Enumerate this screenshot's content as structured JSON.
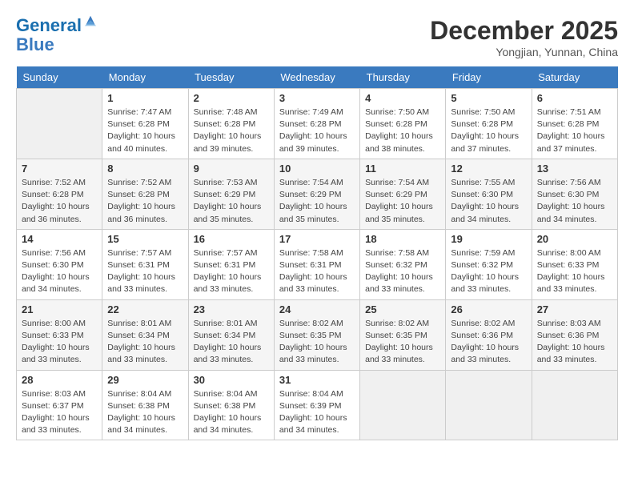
{
  "logo": {
    "line1": "General",
    "line2": "Blue"
  },
  "title": "December 2025",
  "location": "Yongjian, Yunnan, China",
  "days_of_week": [
    "Sunday",
    "Monday",
    "Tuesday",
    "Wednesday",
    "Thursday",
    "Friday",
    "Saturday"
  ],
  "weeks": [
    [
      {
        "day": "",
        "sunrise": "",
        "sunset": "",
        "daylight": ""
      },
      {
        "day": "1",
        "sunrise": "Sunrise: 7:47 AM",
        "sunset": "Sunset: 6:28 PM",
        "daylight": "Daylight: 10 hours and 40 minutes."
      },
      {
        "day": "2",
        "sunrise": "Sunrise: 7:48 AM",
        "sunset": "Sunset: 6:28 PM",
        "daylight": "Daylight: 10 hours and 39 minutes."
      },
      {
        "day": "3",
        "sunrise": "Sunrise: 7:49 AM",
        "sunset": "Sunset: 6:28 PM",
        "daylight": "Daylight: 10 hours and 39 minutes."
      },
      {
        "day": "4",
        "sunrise": "Sunrise: 7:50 AM",
        "sunset": "Sunset: 6:28 PM",
        "daylight": "Daylight: 10 hours and 38 minutes."
      },
      {
        "day": "5",
        "sunrise": "Sunrise: 7:50 AM",
        "sunset": "Sunset: 6:28 PM",
        "daylight": "Daylight: 10 hours and 37 minutes."
      },
      {
        "day": "6",
        "sunrise": "Sunrise: 7:51 AM",
        "sunset": "Sunset: 6:28 PM",
        "daylight": "Daylight: 10 hours and 37 minutes."
      }
    ],
    [
      {
        "day": "7",
        "sunrise": "Sunrise: 7:52 AM",
        "sunset": "Sunset: 6:28 PM",
        "daylight": "Daylight: 10 hours and 36 minutes."
      },
      {
        "day": "8",
        "sunrise": "Sunrise: 7:52 AM",
        "sunset": "Sunset: 6:28 PM",
        "daylight": "Daylight: 10 hours and 36 minutes."
      },
      {
        "day": "9",
        "sunrise": "Sunrise: 7:53 AM",
        "sunset": "Sunset: 6:29 PM",
        "daylight": "Daylight: 10 hours and 35 minutes."
      },
      {
        "day": "10",
        "sunrise": "Sunrise: 7:54 AM",
        "sunset": "Sunset: 6:29 PM",
        "daylight": "Daylight: 10 hours and 35 minutes."
      },
      {
        "day": "11",
        "sunrise": "Sunrise: 7:54 AM",
        "sunset": "Sunset: 6:29 PM",
        "daylight": "Daylight: 10 hours and 35 minutes."
      },
      {
        "day": "12",
        "sunrise": "Sunrise: 7:55 AM",
        "sunset": "Sunset: 6:30 PM",
        "daylight": "Daylight: 10 hours and 34 minutes."
      },
      {
        "day": "13",
        "sunrise": "Sunrise: 7:56 AM",
        "sunset": "Sunset: 6:30 PM",
        "daylight": "Daylight: 10 hours and 34 minutes."
      }
    ],
    [
      {
        "day": "14",
        "sunrise": "Sunrise: 7:56 AM",
        "sunset": "Sunset: 6:30 PM",
        "daylight": "Daylight: 10 hours and 34 minutes."
      },
      {
        "day": "15",
        "sunrise": "Sunrise: 7:57 AM",
        "sunset": "Sunset: 6:31 PM",
        "daylight": "Daylight: 10 hours and 33 minutes."
      },
      {
        "day": "16",
        "sunrise": "Sunrise: 7:57 AM",
        "sunset": "Sunset: 6:31 PM",
        "daylight": "Daylight: 10 hours and 33 minutes."
      },
      {
        "day": "17",
        "sunrise": "Sunrise: 7:58 AM",
        "sunset": "Sunset: 6:31 PM",
        "daylight": "Daylight: 10 hours and 33 minutes."
      },
      {
        "day": "18",
        "sunrise": "Sunrise: 7:58 AM",
        "sunset": "Sunset: 6:32 PM",
        "daylight": "Daylight: 10 hours and 33 minutes."
      },
      {
        "day": "19",
        "sunrise": "Sunrise: 7:59 AM",
        "sunset": "Sunset: 6:32 PM",
        "daylight": "Daylight: 10 hours and 33 minutes."
      },
      {
        "day": "20",
        "sunrise": "Sunrise: 8:00 AM",
        "sunset": "Sunset: 6:33 PM",
        "daylight": "Daylight: 10 hours and 33 minutes."
      }
    ],
    [
      {
        "day": "21",
        "sunrise": "Sunrise: 8:00 AM",
        "sunset": "Sunset: 6:33 PM",
        "daylight": "Daylight: 10 hours and 33 minutes."
      },
      {
        "day": "22",
        "sunrise": "Sunrise: 8:01 AM",
        "sunset": "Sunset: 6:34 PM",
        "daylight": "Daylight: 10 hours and 33 minutes."
      },
      {
        "day": "23",
        "sunrise": "Sunrise: 8:01 AM",
        "sunset": "Sunset: 6:34 PM",
        "daylight": "Daylight: 10 hours and 33 minutes."
      },
      {
        "day": "24",
        "sunrise": "Sunrise: 8:02 AM",
        "sunset": "Sunset: 6:35 PM",
        "daylight": "Daylight: 10 hours and 33 minutes."
      },
      {
        "day": "25",
        "sunrise": "Sunrise: 8:02 AM",
        "sunset": "Sunset: 6:35 PM",
        "daylight": "Daylight: 10 hours and 33 minutes."
      },
      {
        "day": "26",
        "sunrise": "Sunrise: 8:02 AM",
        "sunset": "Sunset: 6:36 PM",
        "daylight": "Daylight: 10 hours and 33 minutes."
      },
      {
        "day": "27",
        "sunrise": "Sunrise: 8:03 AM",
        "sunset": "Sunset: 6:36 PM",
        "daylight": "Daylight: 10 hours and 33 minutes."
      }
    ],
    [
      {
        "day": "28",
        "sunrise": "Sunrise: 8:03 AM",
        "sunset": "Sunset: 6:37 PM",
        "daylight": "Daylight: 10 hours and 33 minutes."
      },
      {
        "day": "29",
        "sunrise": "Sunrise: 8:04 AM",
        "sunset": "Sunset: 6:38 PM",
        "daylight": "Daylight: 10 hours and 34 minutes."
      },
      {
        "day": "30",
        "sunrise": "Sunrise: 8:04 AM",
        "sunset": "Sunset: 6:38 PM",
        "daylight": "Daylight: 10 hours and 34 minutes."
      },
      {
        "day": "31",
        "sunrise": "Sunrise: 8:04 AM",
        "sunset": "Sunset: 6:39 PM",
        "daylight": "Daylight: 10 hours and 34 minutes."
      },
      {
        "day": "",
        "sunrise": "",
        "sunset": "",
        "daylight": ""
      },
      {
        "day": "",
        "sunrise": "",
        "sunset": "",
        "daylight": ""
      },
      {
        "day": "",
        "sunrise": "",
        "sunset": "",
        "daylight": ""
      }
    ]
  ]
}
